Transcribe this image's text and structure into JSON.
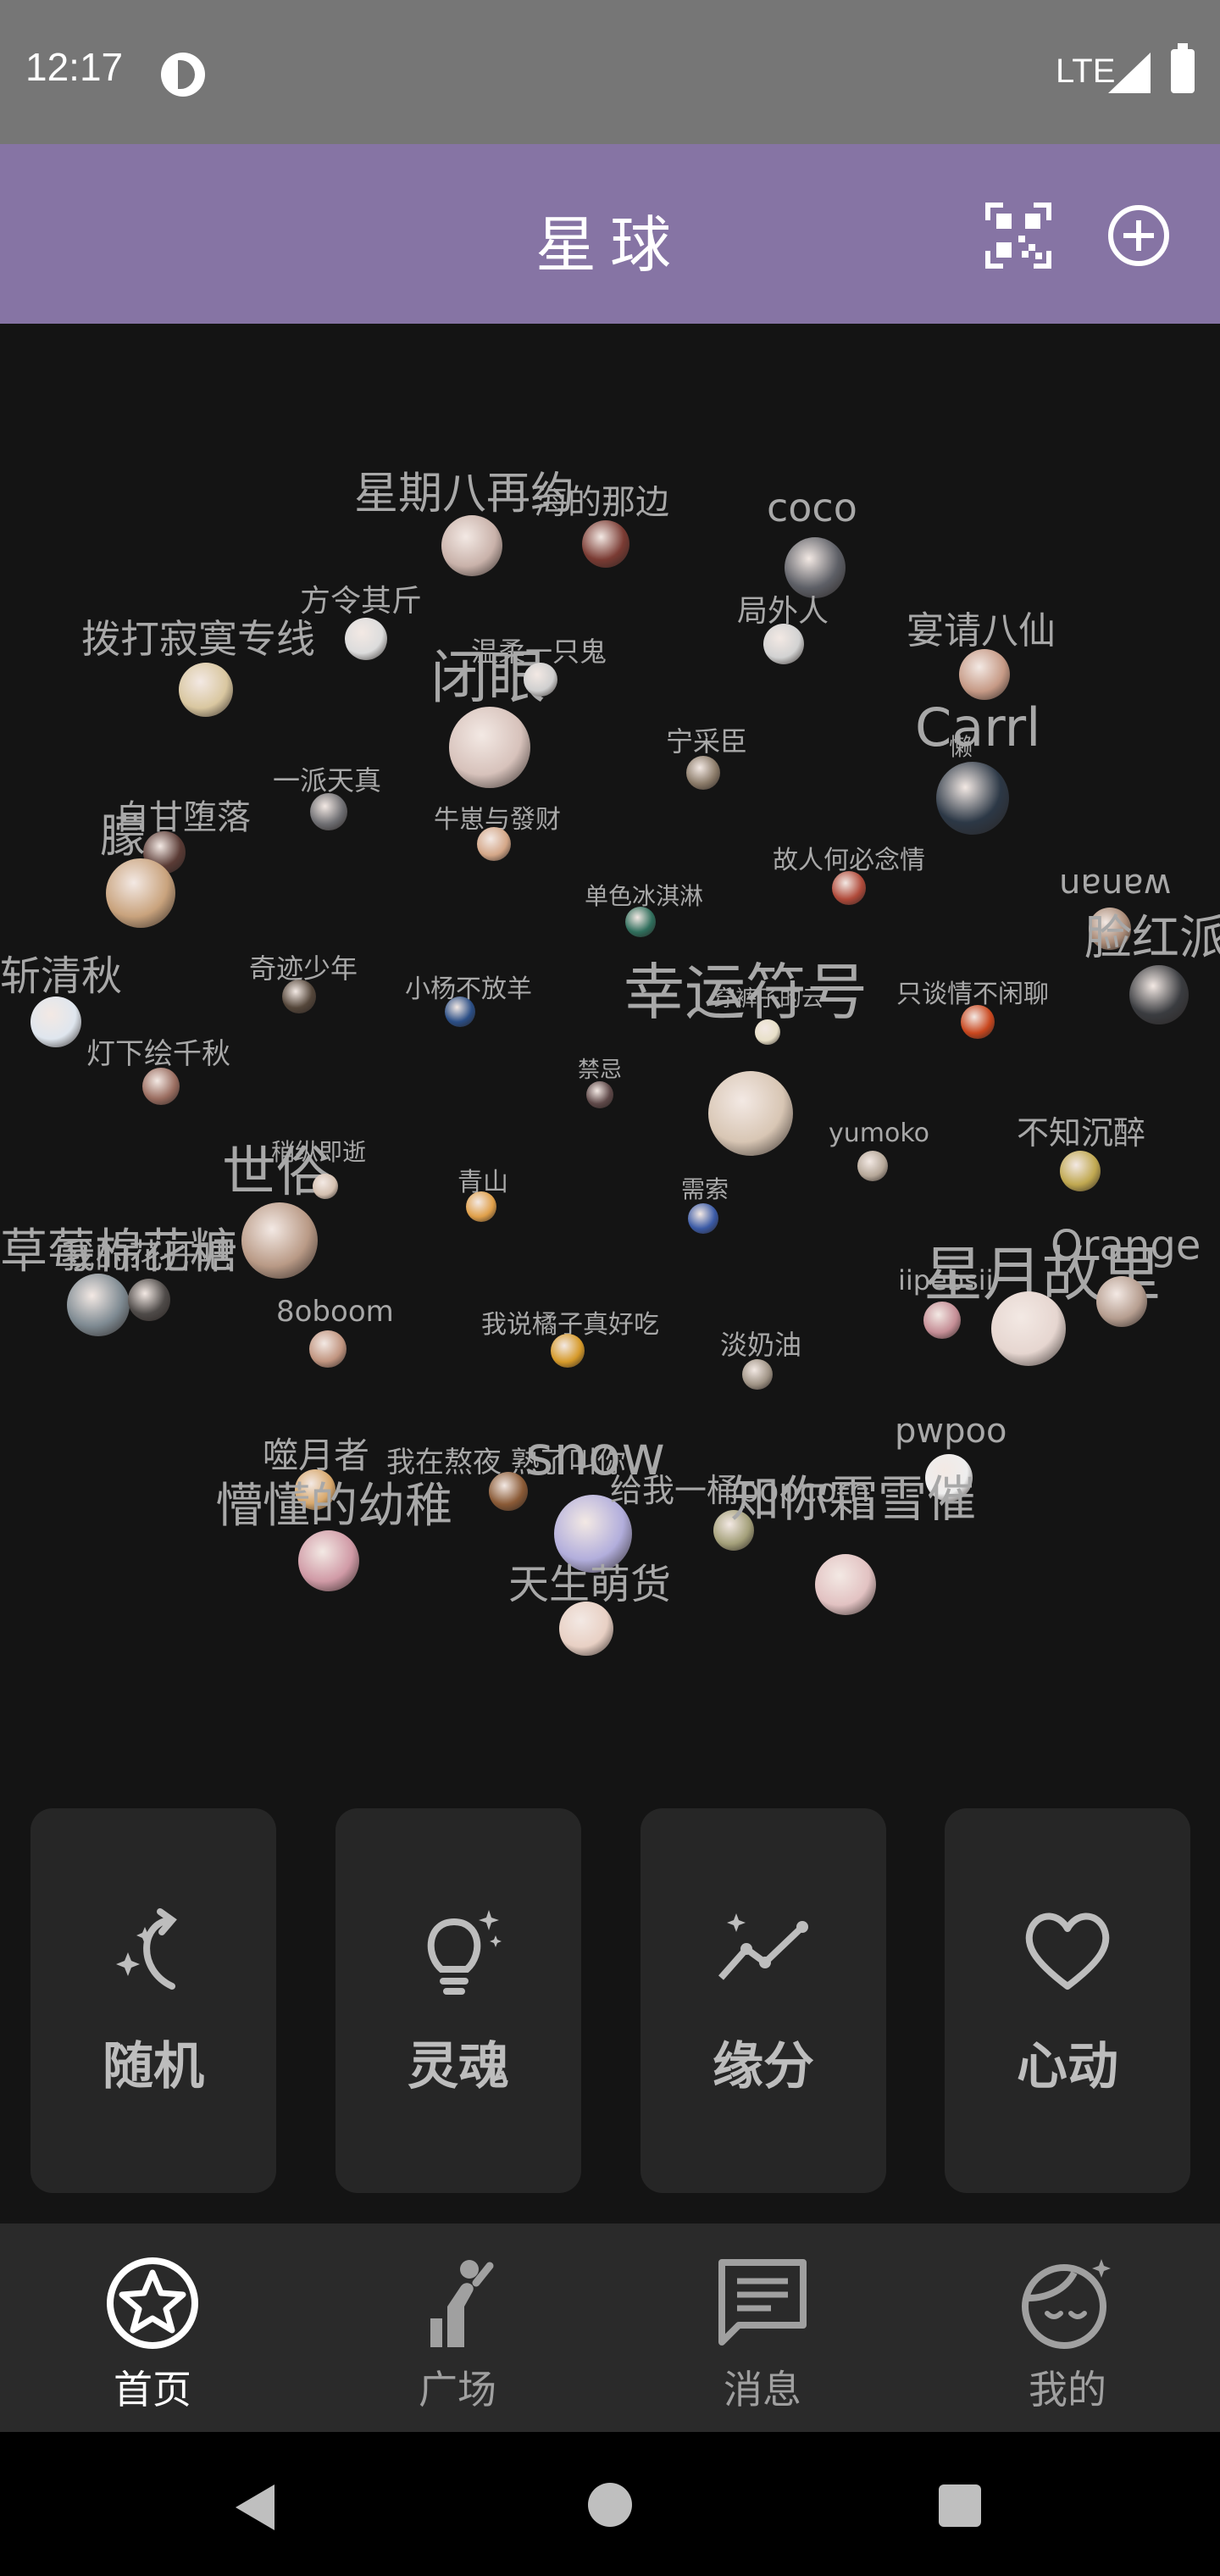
{
  "status_bar": {
    "time": "12:17",
    "network": "LTE"
  },
  "header": {
    "title": "星球",
    "scan_icon": "qr-scan-icon",
    "add_icon": "plus-circle-icon"
  },
  "stars": [
    {
      "name": "星期八再约",
      "size": 54,
      "color": "#c9b2aa"
    },
    {
      "name": "海的那边",
      "size": 40,
      "color": "#7a3b33"
    },
    {
      "name": "coco",
      "size": 48,
      "color": "#5d5f66"
    },
    {
      "name": "方令其斤",
      "size": 36,
      "color": "#dcdcdc"
    },
    {
      "name": "局外人",
      "size": 36,
      "color": "#d2d2d2"
    },
    {
      "name": "宴请八仙",
      "size": 44,
      "color": "#c69a86"
    },
    {
      "name": "拨打寂寞专线",
      "size": 46,
      "color": "#d9c7a0"
    },
    {
      "name": "闭眼",
      "size": 66,
      "color": "#d7c2bb"
    },
    {
      "name": "温柔一只鬼",
      "size": 32,
      "color": "#cfcfcf"
    },
    {
      "name": "宁采臣",
      "size": 32,
      "color": "#8a7a68"
    },
    {
      "name": "Carrl",
      "size": 62,
      "color": "#2c3846"
    },
    {
      "name": "懒",
      "size": 32,
      "color": "#1f2530"
    },
    {
      "name": "一派天真",
      "size": 32,
      "color": "#6e6e72"
    },
    {
      "name": "牛崽与發财",
      "size": 30,
      "color": "#d4a788"
    },
    {
      "name": "自甘堕落",
      "size": 40,
      "color": "#5a3b35"
    },
    {
      "name": "朦",
      "size": 54,
      "color": "#c9a37d"
    },
    {
      "name": "故人何必念情",
      "size": 30,
      "color": "#b04a3a"
    },
    {
      "name": "单色冰淇淋",
      "size": 30,
      "color": "#2f6e5c"
    },
    {
      "name": "wanan",
      "size": 42,
      "color": "#a98a76"
    },
    {
      "name": "脸红派",
      "size": 56,
      "color": "#3a3c40"
    },
    {
      "name": "斩清秋",
      "size": 48,
      "color": "#dfe6ee"
    },
    {
      "name": "奇迹少年",
      "size": 32,
      "color": "#54463a"
    },
    {
      "name": "小杨不放羊",
      "size": 30,
      "color": "#2a4e86"
    },
    {
      "name": "幸运符号",
      "size": 70,
      "color": "#d8c6b4"
    },
    {
      "name": "穿裤子的云",
      "size": 28,
      "color": "#e8e0c8"
    },
    {
      "name": "只谈情不闲聊",
      "size": 30,
      "color": "#c9471e"
    },
    {
      "name": "灯下绘千秋",
      "size": 34,
      "color": "#9a6d60"
    },
    {
      "name": "禁忌",
      "size": 26,
      "color": "#5e4848"
    },
    {
      "name": "yumoko",
      "size": 34,
      "color": "#b6a899"
    },
    {
      "name": "不知沉醉",
      "size": 38,
      "color": "#c0a850"
    },
    {
      "name": "世俗",
      "size": 64,
      "color": "#b99a86"
    },
    {
      "name": "稍纵即逝",
      "size": 28,
      "color": "#d4c0b0"
    },
    {
      "name": "青山",
      "size": 30,
      "color": "#e0a04a"
    },
    {
      "name": "需索",
      "size": 30,
      "color": "#3a5aa6"
    },
    {
      "name": "草莓棉花糖",
      "size": 56,
      "color": "#7e8a92"
    },
    {
      "name": "我的花开吧",
      "size": 44,
      "color": "#4e4a48"
    },
    {
      "name": "星月故里",
      "size": 70,
      "color": "#e6d6d0"
    },
    {
      "name": "Orange",
      "size": 48,
      "color": "#b69e90"
    },
    {
      "name": "iipebsii",
      "size": 34,
      "color": "#c58e96"
    },
    {
      "name": "8oboom",
      "size": 36,
      "color": "#c19580"
    },
    {
      "name": "我说橘子真好吃",
      "size": 32,
      "color": "#d69a2a"
    },
    {
      "name": "淡奶油",
      "size": 30,
      "color": "#a09486"
    },
    {
      "name": "pwpoo",
      "size": 44,
      "color": "#eeeeee"
    },
    {
      "name": "噬月者",
      "size": 38,
      "color": "#d8a86c"
    },
    {
      "name": "我在熬夜 熟了叫你",
      "size": 38,
      "color": "#8a5a36"
    },
    {
      "name": "snow",
      "size": 64,
      "color": "#b2aedc"
    },
    {
      "name": "给我一桶popcorn",
      "size": 40,
      "color": "#a4a07a"
    },
    {
      "name": "懵懂的幼稚",
      "size": 56,
      "color": "#d09aa6"
    },
    {
      "name": "知你霜雪催",
      "size": 58,
      "color": "#e2c2c2"
    },
    {
      "name": "天生萌货",
      "size": 50,
      "color": "#e8d0c4"
    }
  ],
  "modes": [
    {
      "label": "随机",
      "icon": "random-sparkle-icon"
    },
    {
      "label": "灵魂",
      "icon": "lightbulb-sparkle-icon"
    },
    {
      "label": "缘分",
      "icon": "trend-sparkle-icon"
    },
    {
      "label": "心动",
      "icon": "heart-icon"
    }
  ],
  "nav": [
    {
      "label": "首页",
      "icon": "star-circle-icon",
      "active": true
    },
    {
      "label": "广场",
      "icon": "figure-icon",
      "active": false
    },
    {
      "label": "消息",
      "icon": "message-icon",
      "active": false
    },
    {
      "label": "我的",
      "icon": "profile-face-icon",
      "active": false
    }
  ],
  "colors": {
    "accent": "#8674a4",
    "background": "#141414",
    "card": "#262626",
    "nav_bg": "#2a2a2a"
  }
}
